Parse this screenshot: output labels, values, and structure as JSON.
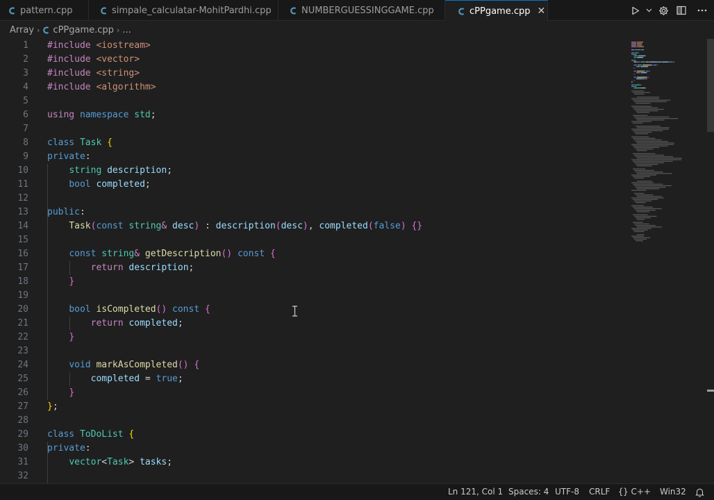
{
  "tabs": [
    {
      "label": "pattern.cpp",
      "active": false
    },
    {
      "label": "simpale_calculatar-MohitPardhi.cpp",
      "active": false
    },
    {
      "label": "NUMBERGUESSINGGAME.cpp",
      "active": false
    },
    {
      "label": "cPPgame.cpp",
      "active": true
    }
  ],
  "tab_close_glyph": "✕",
  "tab_actions": [
    "run-icon",
    "dropdown-icon",
    "gear-icon",
    "split-editor-icon",
    "more-icon"
  ],
  "breadcrumb": {
    "folder": "Array",
    "file": "cPPgame.cpp",
    "sep": "›",
    "ellipsis": "..."
  },
  "colors": {
    "editor_bg": "#1f1f1f",
    "tab_active_border": "#0078d4",
    "keyword": "#c586c0",
    "storage": "#569cd6",
    "type": "#4ec9b0",
    "function": "#dcdcaa",
    "variable": "#9cdcfe",
    "string": "#ce9178",
    "cpp_icon": "#519aba"
  },
  "code_lines": [
    {
      "n": "1",
      "t": [
        [
          "kw",
          "#include"
        ],
        [
          "txt",
          " "
        ],
        [
          "str",
          "<iostream>"
        ]
      ]
    },
    {
      "n": "2",
      "t": [
        [
          "kw",
          "#include"
        ],
        [
          "txt",
          " "
        ],
        [
          "str",
          "<vector>"
        ]
      ]
    },
    {
      "n": "3",
      "t": [
        [
          "kw",
          "#include"
        ],
        [
          "txt",
          " "
        ],
        [
          "str",
          "<string>"
        ]
      ]
    },
    {
      "n": "4",
      "t": [
        [
          "kw",
          "#include"
        ],
        [
          "txt",
          " "
        ],
        [
          "str",
          "<algorithm>"
        ]
      ]
    },
    {
      "n": "5",
      "t": []
    },
    {
      "n": "6",
      "t": [
        [
          "kw",
          "using"
        ],
        [
          "txt",
          " "
        ],
        [
          "kb",
          "namespace"
        ],
        [
          "txt",
          " "
        ],
        [
          "ty",
          "std"
        ],
        [
          "txt",
          ";"
        ]
      ]
    },
    {
      "n": "7",
      "t": []
    },
    {
      "n": "8",
      "t": [
        [
          "kb",
          "class"
        ],
        [
          "txt",
          " "
        ],
        [
          "ty",
          "Task"
        ],
        [
          "txt",
          " "
        ],
        [
          "br1",
          "{"
        ]
      ]
    },
    {
      "n": "9",
      "t": [
        [
          "kb",
          "private"
        ],
        [
          "txt",
          ":"
        ]
      ]
    },
    {
      "n": "10",
      "t": [
        [
          "txt",
          "    "
        ],
        [
          "ty",
          "string"
        ],
        [
          "txt",
          " "
        ],
        [
          "var",
          "description"
        ],
        [
          "txt",
          ";"
        ]
      ]
    },
    {
      "n": "11",
      "t": [
        [
          "txt",
          "    "
        ],
        [
          "kb",
          "bool"
        ],
        [
          "txt",
          " "
        ],
        [
          "var",
          "completed"
        ],
        [
          "txt",
          ";"
        ]
      ]
    },
    {
      "n": "12",
      "t": []
    },
    {
      "n": "13",
      "t": [
        [
          "kb",
          "public"
        ],
        [
          "txt",
          ":"
        ]
      ]
    },
    {
      "n": "14",
      "t": [
        [
          "txt",
          "    "
        ],
        [
          "fn",
          "Task"
        ],
        [
          "br2",
          "("
        ],
        [
          "kb",
          "const"
        ],
        [
          "txt",
          " "
        ],
        [
          "ty",
          "string"
        ],
        [
          "kw",
          "&"
        ],
        [
          "txt",
          " "
        ],
        [
          "var",
          "desc"
        ],
        [
          "br2",
          ")"
        ],
        [
          "txt",
          " : "
        ],
        [
          "var",
          "description"
        ],
        [
          "br2",
          "("
        ],
        [
          "var",
          "desc"
        ],
        [
          "br2",
          ")"
        ],
        [
          "txt",
          ", "
        ],
        [
          "var",
          "completed"
        ],
        [
          "br2",
          "("
        ],
        [
          "kb",
          "false"
        ],
        [
          "br2",
          ")"
        ],
        [
          "txt",
          " "
        ],
        [
          "br2",
          "{}"
        ]
      ]
    },
    {
      "n": "15",
      "t": []
    },
    {
      "n": "16",
      "t": [
        [
          "txt",
          "    "
        ],
        [
          "kb",
          "const"
        ],
        [
          "txt",
          " "
        ],
        [
          "ty",
          "string"
        ],
        [
          "kw",
          "&"
        ],
        [
          "txt",
          " "
        ],
        [
          "fn",
          "getDescription"
        ],
        [
          "br2",
          "()"
        ],
        [
          "txt",
          " "
        ],
        [
          "kb",
          "const"
        ],
        [
          "txt",
          " "
        ],
        [
          "br2",
          "{"
        ]
      ]
    },
    {
      "n": "17",
      "t": [
        [
          "txt",
          "        "
        ],
        [
          "kw",
          "return"
        ],
        [
          "txt",
          " "
        ],
        [
          "var",
          "description"
        ],
        [
          "txt",
          ";"
        ]
      ]
    },
    {
      "n": "18",
      "t": [
        [
          "txt",
          "    "
        ],
        [
          "br2",
          "}"
        ]
      ]
    },
    {
      "n": "19",
      "t": []
    },
    {
      "n": "20",
      "t": [
        [
          "txt",
          "    "
        ],
        [
          "kb",
          "bool"
        ],
        [
          "txt",
          " "
        ],
        [
          "fn",
          "isCompleted"
        ],
        [
          "br2",
          "()"
        ],
        [
          "txt",
          " "
        ],
        [
          "kb",
          "const"
        ],
        [
          "txt",
          " "
        ],
        [
          "br2",
          "{"
        ]
      ]
    },
    {
      "n": "21",
      "t": [
        [
          "txt",
          "        "
        ],
        [
          "kw",
          "return"
        ],
        [
          "txt",
          " "
        ],
        [
          "var",
          "completed"
        ],
        [
          "txt",
          ";"
        ]
      ]
    },
    {
      "n": "22",
      "t": [
        [
          "txt",
          "    "
        ],
        [
          "br2",
          "}"
        ]
      ]
    },
    {
      "n": "23",
      "t": []
    },
    {
      "n": "24",
      "t": [
        [
          "txt",
          "    "
        ],
        [
          "kb",
          "void"
        ],
        [
          "txt",
          " "
        ],
        [
          "fn",
          "markAsCompleted"
        ],
        [
          "br2",
          "()"
        ],
        [
          "txt",
          " "
        ],
        [
          "br2",
          "{"
        ]
      ]
    },
    {
      "n": "25",
      "t": [
        [
          "txt",
          "        "
        ],
        [
          "var",
          "completed"
        ],
        [
          "txt",
          " = "
        ],
        [
          "kb",
          "true"
        ],
        [
          "txt",
          ";"
        ]
      ]
    },
    {
      "n": "26",
      "t": [
        [
          "txt",
          "    "
        ],
        [
          "br2",
          "}"
        ]
      ]
    },
    {
      "n": "27",
      "t": [
        [
          "br1",
          "}"
        ],
        [
          "txt",
          ";"
        ]
      ]
    },
    {
      "n": "28",
      "t": []
    },
    {
      "n": "29",
      "t": [
        [
          "kb",
          "class"
        ],
        [
          "txt",
          " "
        ],
        [
          "ty",
          "ToDoList"
        ],
        [
          "txt",
          " "
        ],
        [
          "br1",
          "{"
        ]
      ]
    },
    {
      "n": "30",
      "t": [
        [
          "kb",
          "private"
        ],
        [
          "txt",
          ":"
        ]
      ]
    },
    {
      "n": "31",
      "t": [
        [
          "txt",
          "    "
        ],
        [
          "ty",
          "vector"
        ],
        [
          "txt",
          "<"
        ],
        [
          "ty",
          "Task"
        ],
        [
          "txt",
          "> "
        ],
        [
          "var",
          "tasks"
        ],
        [
          "txt",
          ";"
        ]
      ]
    },
    {
      "n": "32",
      "t": []
    }
  ],
  "status": {
    "position": "Ln 121, Col 1",
    "spaces": "Spaces: 4",
    "encoding": "UTF-8",
    "eol": "CRLF",
    "language_braces": "{}",
    "language": "C++",
    "platform": "Win32"
  }
}
